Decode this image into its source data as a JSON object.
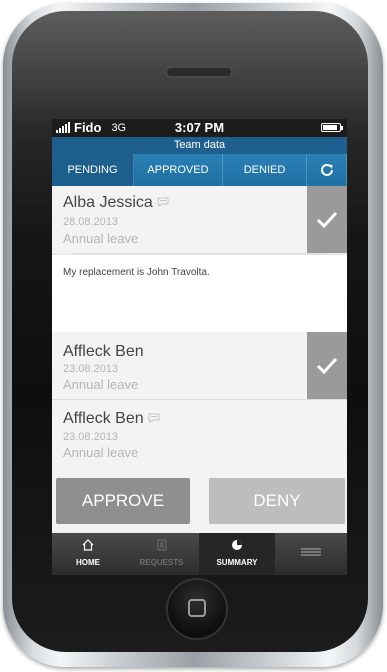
{
  "status_bar": {
    "carrier": "Fido",
    "network": "3G",
    "time": "3:07 PM",
    "battery_level": 0.85
  },
  "header": {
    "title": "Team data"
  },
  "tabs": [
    {
      "label": "PENDING",
      "active": true
    },
    {
      "label": "APPROVED",
      "active": false
    },
    {
      "label": "DENIED",
      "active": false
    }
  ],
  "requests": [
    {
      "name": "Alba Jessica",
      "date": "28.08.2013",
      "type": "Annual leave",
      "has_comment": true,
      "comment": "My replacement is John Travolta."
    },
    {
      "name": "Affleck Ben",
      "date": "23.08.2013",
      "type": "Annual leave",
      "has_comment": false
    },
    {
      "name": "Affleck Ben",
      "date": "23.08.2013",
      "type": "Annual leave",
      "has_comment": true
    }
  ],
  "actions": {
    "approve_label": "APPROVE",
    "deny_label": "DENY"
  },
  "bottom_nav": [
    {
      "label": "HOME",
      "icon": "home-icon"
    },
    {
      "label": "REQUESTS",
      "icon": "document-icon"
    },
    {
      "label": "SUMMARY",
      "icon": "pie-chart-icon"
    },
    {
      "label": "",
      "icon": "menu-icon"
    }
  ],
  "colors": {
    "header_bg": "#1f5f8f",
    "tab_bg": "#2a80b5",
    "check_bg": "#9a9a9a",
    "approve_bg": "#8f8f8f",
    "deny_bg": "#bdbdbd"
  }
}
